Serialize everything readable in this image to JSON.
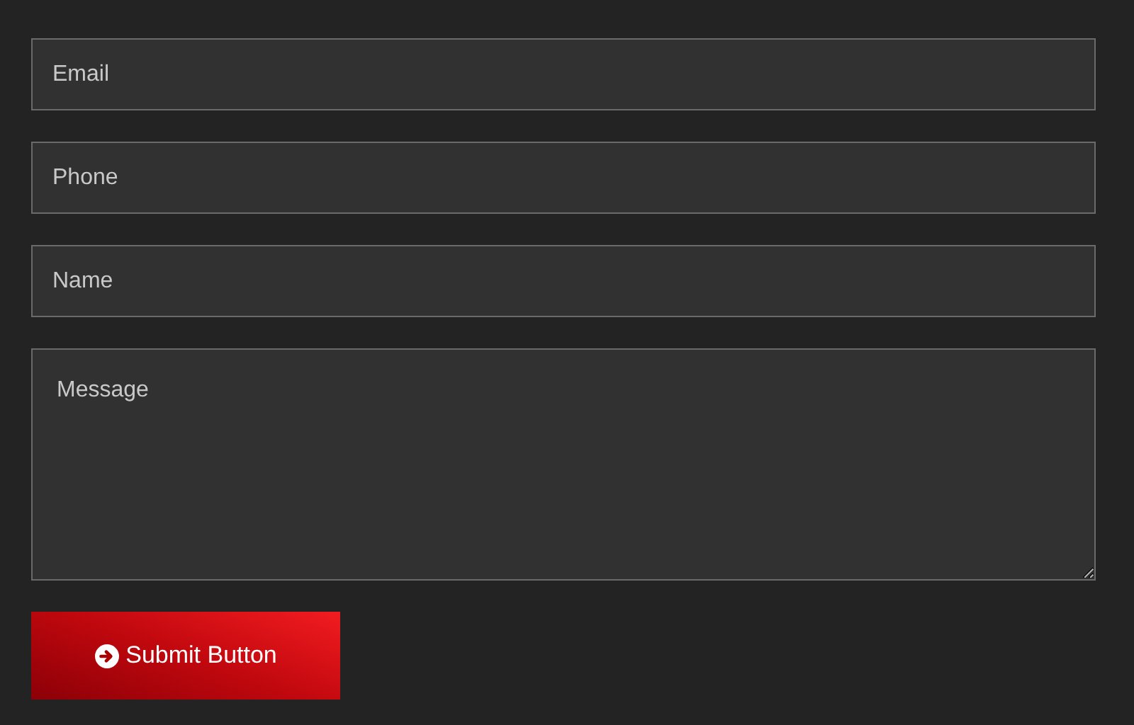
{
  "fields": [
    {
      "kind": "input",
      "placeholder": "Email"
    },
    {
      "kind": "input",
      "placeholder": "Phone"
    },
    {
      "kind": "input",
      "placeholder": "Name"
    },
    {
      "kind": "textarea",
      "placeholder": "Message"
    }
  ],
  "submit_button": {
    "label": "Submit Button"
  }
}
